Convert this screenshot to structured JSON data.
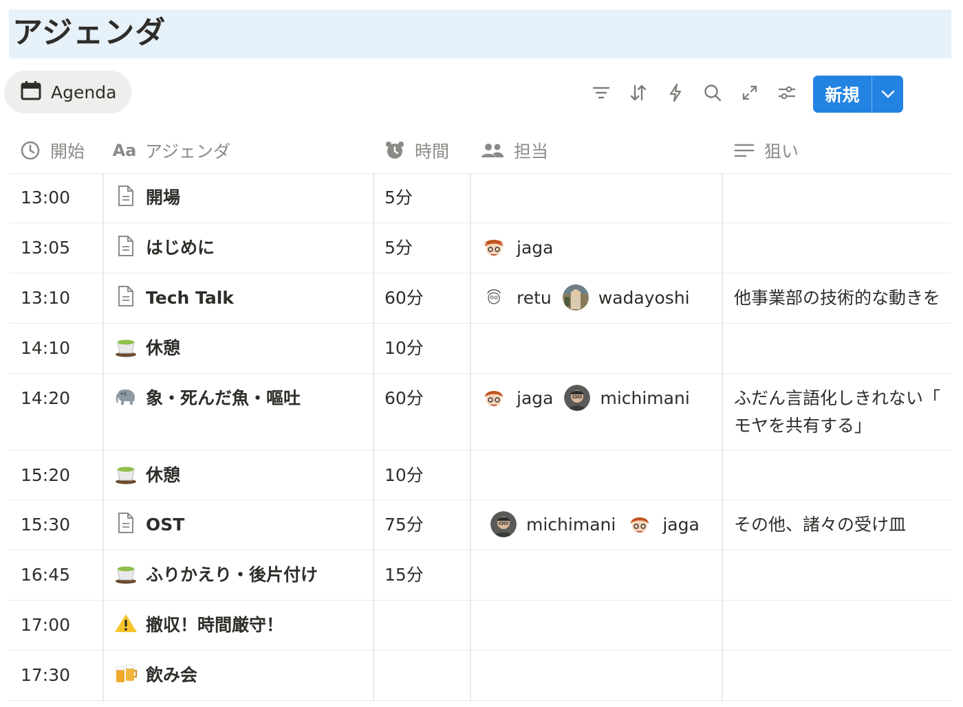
{
  "page": {
    "title": "アジェンダ"
  },
  "view": {
    "tab_label": "Agenda",
    "icon": "calendar-icon"
  },
  "toolbar": {
    "icons": [
      "filter-icon",
      "sort-icon",
      "automation-icon",
      "search-icon",
      "expand-icon",
      "settings-icon"
    ],
    "new_label": "新規"
  },
  "columns": [
    {
      "label": "開始",
      "icon": "clock-icon"
    },
    {
      "label": "アジェンダ",
      "icon": "title-icon",
      "icon_text": "Aa"
    },
    {
      "label": "時間",
      "icon": "alarm-icon"
    },
    {
      "label": "担当",
      "icon": "people-icon"
    },
    {
      "label": "狙い",
      "icon": "text-lines-icon"
    }
  ],
  "rows": [
    {
      "start": "13:00",
      "title": "開場",
      "icon": "page-icon",
      "duration": "5分",
      "owners": [],
      "goal": ""
    },
    {
      "start": "13:05",
      "title": "はじめに",
      "icon": "page-icon",
      "duration": "5分",
      "owners": [
        "jaga"
      ],
      "goal": ""
    },
    {
      "start": "13:10",
      "title": "Tech Talk",
      "icon": "page-icon",
      "duration": "60分",
      "owners": [
        "retu",
        "wadayoshi"
      ],
      "goal": "他事業部の技術的な動きを"
    },
    {
      "start": "14:10",
      "title": "休憩",
      "icon": "tea-icon",
      "duration": "10分",
      "owners": [],
      "goal": ""
    },
    {
      "start": "14:20",
      "title": "象・死んだ魚・嘔吐",
      "icon": "elephant-icon",
      "duration": "60分",
      "owners": [
        "jaga",
        "michimani"
      ],
      "goal": "ふだん言語化しきれない「",
      "goal2": "モヤを共有する」"
    },
    {
      "start": "15:20",
      "title": "休憩",
      "icon": "tea-icon",
      "duration": "10分",
      "owners": [],
      "goal": ""
    },
    {
      "start": "15:30",
      "title": "OST",
      "icon": "page-icon",
      "duration": "75分",
      "owners": [
        "michimani",
        "jaga"
      ],
      "goal": "その他、諸々の受け皿"
    },
    {
      "start": "16:45",
      "title": "ふりかえり・後片付け",
      "icon": "tea-icon",
      "duration": "15分",
      "owners": [],
      "goal": ""
    },
    {
      "start": "17:00",
      "title": "撤収！時間厳守！",
      "icon": "warning-icon",
      "duration": "",
      "owners": [],
      "goal": ""
    },
    {
      "start": "17:30",
      "title": "飲み会",
      "icon": "beer-icon",
      "duration": "",
      "owners": [],
      "goal": ""
    }
  ],
  "colors": {
    "accent": "#2383e2",
    "title_bg": "#e7f1fa",
    "tab_bg": "#efeeec"
  }
}
